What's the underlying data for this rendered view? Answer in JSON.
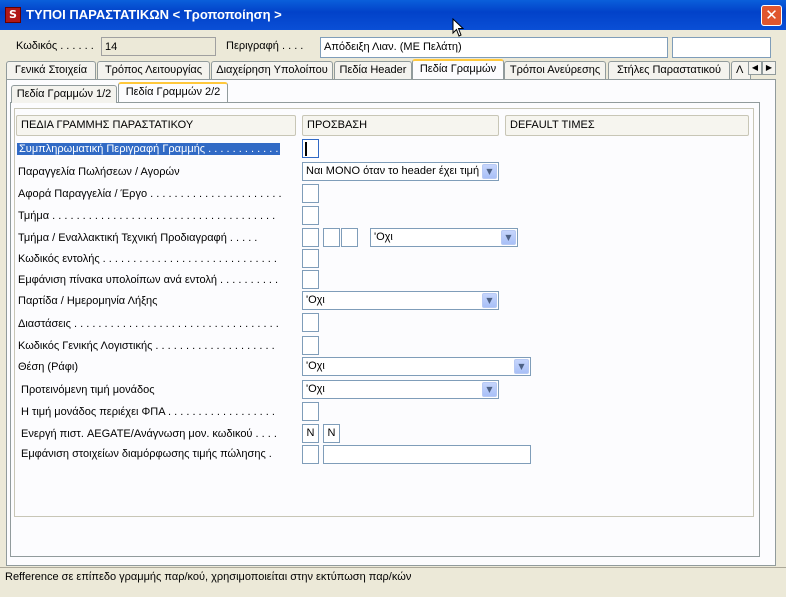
{
  "window": {
    "title": "ΤΥΠΟΙ ΠΑΡΑΣΤΑΤΙΚΩΝ < Τροποποίηση >",
    "close_label": "✕"
  },
  "header": {
    "code_label": "Κωδικός . . . . . .",
    "code_value": "14",
    "desc_label": "Περιγραφή . . . .",
    "desc_value": "Απόδειξη Λιαν. (ΜΕ Πελάτη)",
    "extra_value": ""
  },
  "tabs": [
    {
      "label": "Γενικά Στοιχεία",
      "active": false
    },
    {
      "label": "Τρόπος Λειτουργίας",
      "active": false
    },
    {
      "label": "Διαχείρηση Υπολοίπου",
      "active": false
    },
    {
      "label": "Πεδία Header",
      "active": false
    },
    {
      "label": "Πεδία Γραμμών",
      "active": true
    },
    {
      "label": "Τρόποι Ανεύρεσης",
      "active": false
    },
    {
      "label": "Στήλες Παραστατικού",
      "active": false
    },
    {
      "label": "Λ",
      "active": false
    }
  ],
  "subtabs": [
    {
      "label": "Πεδία Γραμμών 1/2",
      "active": false
    },
    {
      "label": "Πεδία Γραμμών 2/2",
      "active": true
    }
  ],
  "columns": {
    "field": "ΠΕΔΙΑ ΓΡΑΜΜΗΣ ΠΑΡΑΣΤΑΤΙΚΟΥ",
    "access": "ΠΡΟΣΒΑΣΗ",
    "defaults": "DEFAULT ΤΙΜΕΣ"
  },
  "rows": [
    {
      "label": "Συμπληρωματική Περιγραφή Γραμμής . . . . . . . . . . . .",
      "selected": true,
      "access": ""
    },
    {
      "label": "Παραγγελία Πωλήσεων / Αγορών",
      "combo": "Ναι ΜΟΝΟ όταν το header έχει τιμή"
    },
    {
      "label": "Αφορά Παραγγελία / Έργο . . . . . . . . . . . . . . . . . . . . . .",
      "access": ""
    },
    {
      "label": "Τμήμα . . . . . . . . . . . . . . . . . . . . . . . . . . . . . . . . . . . . .",
      "access": ""
    },
    {
      "label": "Τμήμα / Εναλλακτική Τεχνική Προδιαγραφή . . . . .",
      "access": "",
      "combo": "'Οχι"
    },
    {
      "label": "Κωδικός εντολής . . . . . . . . . . . . . . . . . . . . . . . . . . . . .",
      "access": ""
    },
    {
      "label": "Εμφάνιση πίνακα υπολοίπων ανά εντολή . . . . . . . . . .",
      "access": ""
    },
    {
      "label": "Παρτίδα / Ημερομηνία  Λήξης",
      "combo": "'Οχι"
    },
    {
      "label": "Διαστάσεις . . . . . . . . . . . . . . . . . . . . . . . . . . . . . . . . . .",
      "access": ""
    },
    {
      "label": "Κωδικός Γενικής Λογιστικής . . . . . . . . . . . . . . . . . . . .",
      "access": ""
    },
    {
      "label": "Θέση (Ράφι)",
      "combo": "'Οχι"
    },
    {
      "label": "Προτεινόμενη τιμή μονάδος",
      "combo": "'Οχι"
    },
    {
      "label": "Η τιμή μονάδος περιέχει ΦΠΑ . . . . . . . . . . . . . . . . . .",
      "access": ""
    },
    {
      "label": "Ενεργή πιστ. AEGATE/Ανάγνωση μον. κωδικού . . . .",
      "access": "N",
      "access2": "N"
    },
    {
      "label": "Εμφάνιση στοιχείων διαμόρφωσης τιμής πώλησης .",
      "access": "",
      "text": ""
    }
  ],
  "status_text": "Refference σε επίπεδο γραμμής παρ/κού, χρησιμοποιείται στην εκτύπωση παρ/κών"
}
